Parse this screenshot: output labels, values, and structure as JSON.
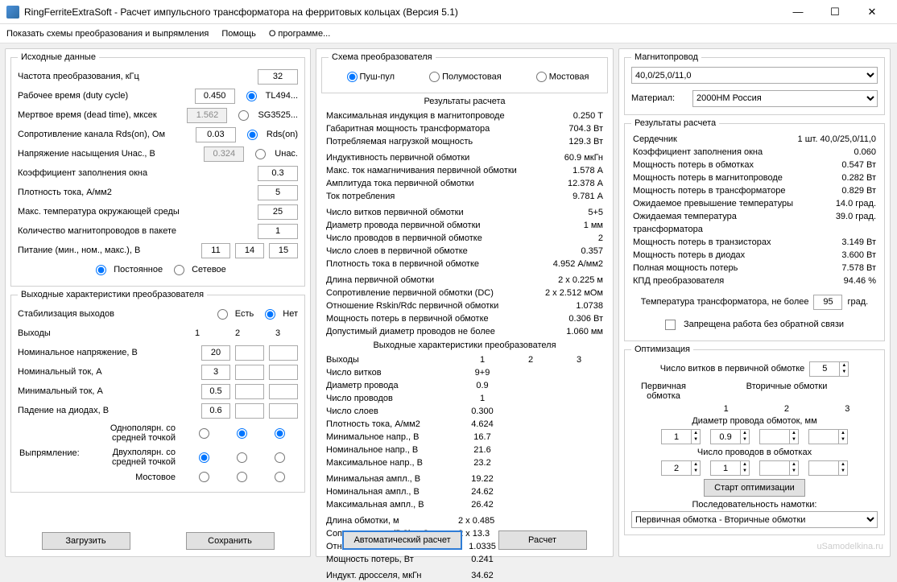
{
  "window": {
    "title": "RingFerriteExtraSoft - Расчет импульсного трансформатора на ферритовых кольцах (Версия 5.1)"
  },
  "menu": {
    "m1": "Показать схемы преобразования и выпрямления",
    "m2": "Помощь",
    "m3": "О программе..."
  },
  "input": {
    "title": "Исходные данные",
    "freq_lbl": "Частота преобразования, кГц",
    "freq": "32",
    "duty_lbl": "Рабочее время (duty cycle)",
    "duty": "0.450",
    "duty_r": "TL494...",
    "dead_lbl": "Мертвое время (dead time), мксек",
    "dead": "1.562",
    "dead_r": "SG3525...",
    "rds_lbl": "Сопротивление канала Rds(on), Ом",
    "rds": "0.03",
    "rds_r": "Rds(on)",
    "usat_lbl": "Напряжение насыщения Uнас., В",
    "usat": "0.324",
    "usat_r": "Uнас.",
    "kfill_lbl": "Коэффициент заполнения окна",
    "kfill": "0.3",
    "jcur_lbl": "Плотность тока, А/мм2",
    "jcur": "5",
    "tmax_lbl": "Макс. температура окружающей среды",
    "tmax": "25",
    "ncore_lbl": "Количество магнитопроводов в пакете",
    "ncore": "1",
    "power_lbl": "Питание (мин., ном., макс.), В",
    "pmin": "11",
    "pnom": "14",
    "pmax": "15",
    "ptype1": "Постоянное",
    "ptype2": "Сетевое"
  },
  "outchar": {
    "title": "Выходные характеристики преобразователя",
    "stab_lbl": "Стабилизация выходов",
    "stab_y": "Есть",
    "stab_n": "Нет",
    "outs_lbl": "Выходы",
    "h1": "1",
    "h2": "2",
    "h3": "3",
    "vnom_lbl": "Номинальное напряжение, В",
    "vnom": "20",
    "inom_lbl": "Номинальный ток, А",
    "inom": "3",
    "imin_lbl": "Минимальный ток, А",
    "imin": "0.5",
    "vdrop_lbl": "Падение на диодах, В",
    "vdrop": "0.6",
    "rect_lbl": "Выпрямление:",
    "rect1": "Однополярн. со средней точкой",
    "rect2": "Двухполярн. со средней точкой",
    "rect3": "Мостовое"
  },
  "btns": {
    "load": "Загрузить",
    "save": "Сохранить",
    "autocalc": "Автоматический расчет",
    "calc": "Расчет"
  },
  "scheme": {
    "title": "Схема преобразователя",
    "s1": "Пуш-пул",
    "s2": "Полумостовая",
    "s3": "Мостовая"
  },
  "results": {
    "title": "Результаты расчета",
    "r1": {
      "l": "Максимальная индукция в магнитопроводе",
      "v": "0.250 Т"
    },
    "r2": {
      "l": "Габаритная мощность трансформатора",
      "v": "704.3 Вт"
    },
    "r3": {
      "l": "Потребляемая нагрузкой мощность",
      "v": "129.3 Вт"
    },
    "r4": {
      "l": "Индуктивность первичной обмотки",
      "v": "60.9 мкГн"
    },
    "r5": {
      "l": "Макс. ток намагничивания первичной обмотки",
      "v": "1.578 А"
    },
    "r6": {
      "l": "Амплитуда тока первичной обмотки",
      "v": "12.378 А"
    },
    "r7": {
      "l": "Ток потребления",
      "v": "9.781 А"
    },
    "r8": {
      "l": "Число витков первичной обмотки",
      "v": "5+5"
    },
    "r9": {
      "l": "Диаметр провода первичной обмотки",
      "v": "1 мм"
    },
    "r10": {
      "l": "Число проводов в первичной обмотке",
      "v": "2"
    },
    "r11": {
      "l": "Число слоев в первичной обмотке",
      "v": "0.357"
    },
    "r12": {
      "l": "Плотность тока в первичной обмотке",
      "v": "4.952 А/мм2"
    },
    "r13": {
      "l": "Длина первичной обмотки",
      "v": "2 x 0.225 м"
    },
    "r14": {
      "l": "Сопротивление первичной обмотки (DC)",
      "v": "2 x 2.512 мОм"
    },
    "r15": {
      "l": "Отношение Rskin/Rdc первичной обмотки",
      "v": "1.0738"
    },
    "r16": {
      "l": "Мощность потерь в первичной обмотке",
      "v": "0.306 Вт"
    },
    "r17": {
      "l": "Допустимый диаметр проводов не более",
      "v": "1.060 мм"
    }
  },
  "outres": {
    "title": "Выходные характеристики преобразователя",
    "hdr_l": "Выходы",
    "h1": "1",
    "h2": "2",
    "h3": "3",
    "o1": {
      "l": "Число витков",
      "v": "9+9"
    },
    "o2": {
      "l": "Диаметр провода",
      "v": "0.9"
    },
    "o3": {
      "l": "Число проводов",
      "v": "1"
    },
    "o4": {
      "l": "Число слоев",
      "v": "0.300"
    },
    "o5": {
      "l": "Плотность тока, А/мм2",
      "v": "4.624"
    },
    "o6": {
      "l": "Минимальное напр., В",
      "v": "16.7"
    },
    "o7": {
      "l": "Номинальное напр., В",
      "v": "21.6"
    },
    "o8": {
      "l": "Максимальное напр., В",
      "v": "23.2"
    },
    "o9": {
      "l": "Минимальная ампл., В",
      "v": "19.22"
    },
    "o10": {
      "l": "Номинальная ампл., В",
      "v": "24.62"
    },
    "o11": {
      "l": "Максимальная ампл., В",
      "v": "26.42"
    },
    "o12": {
      "l": "Длина обмотки, м",
      "v": "2 x 0.485"
    },
    "o13": {
      "l": "Сопротивление (DC), мОм",
      "v": "2 x 13.3"
    },
    "o14": {
      "l": "Отношение Rskin/Rdc",
      "v": "1.0335"
    },
    "o15": {
      "l": "Мощность потерь, Вт",
      "v": "0.241"
    },
    "o16": {
      "l": "Индукт. дросселя, мкГн",
      "v": "34.62"
    }
  },
  "core": {
    "title": "Магнитопровод",
    "size": "40,0/25,0/11,0",
    "mat_lbl": "Материал:",
    "mat": "2000НМ Россия"
  },
  "rres": {
    "title": "Результаты расчета",
    "c1": {
      "l": "Сердечник",
      "v": "1 шт. 40,0/25,0/11,0"
    },
    "c2": {
      "l": "Коэффициент заполнения окна",
      "v": "0.060"
    },
    "c3": {
      "l": "Мощность потерь в обмотках",
      "v": "0.547 Вт"
    },
    "c4": {
      "l": "Мощность потерь в магнитопроводе",
      "v": "0.282 Вт"
    },
    "c5": {
      "l": "Мощность потерь в трансформаторе",
      "v": "0.829 Вт"
    },
    "c6": {
      "l": "Ожидаемое превышение температуры",
      "v": "14.0 град."
    },
    "c7": {
      "l": "Ожидаемая температура трансформатора",
      "v": "39.0 град."
    },
    "c8": {
      "l": "Мощность потерь в транзисторах",
      "v": "3.149 Вт"
    },
    "c9": {
      "l": "Мощность потерь в диодах",
      "v": "3.600 Вт"
    },
    "c10": {
      "l": "Полная мощность потерь",
      "v": "7.578 Вт"
    },
    "c11": {
      "l": "КПД преобразователя",
      "v": "94.46 %"
    },
    "tmax_lbl": "Температура трансформатора, не более",
    "tmax": "95",
    "tmax_u": "град.",
    "nofb": "Запрещена работа без обратной связи"
  },
  "opt": {
    "title": "Оптимизация",
    "nprim_lbl": "Число витков в первичной обмотке",
    "nprim": "5",
    "hdr1": "Первичная обмотка",
    "hdr2": "Вторичные обмотки",
    "sh1": "1",
    "sh2": "2",
    "sh3": "3",
    "dia_lbl": "Диаметр провода обмоток, мм",
    "d0": "1",
    "d1": "0.9",
    "d2": "",
    "d3": "",
    "nw_lbl": "Число проводов в обмотках",
    "n0": "2",
    "n1": "1",
    "n2": "",
    "n3": "",
    "start": "Старт оптимизации",
    "seq_lbl": "Последовательность намотки:",
    "seq": "Первичная обмотка - Вторичные обмотки"
  },
  "watermark": "uSamodelkina.ru"
}
